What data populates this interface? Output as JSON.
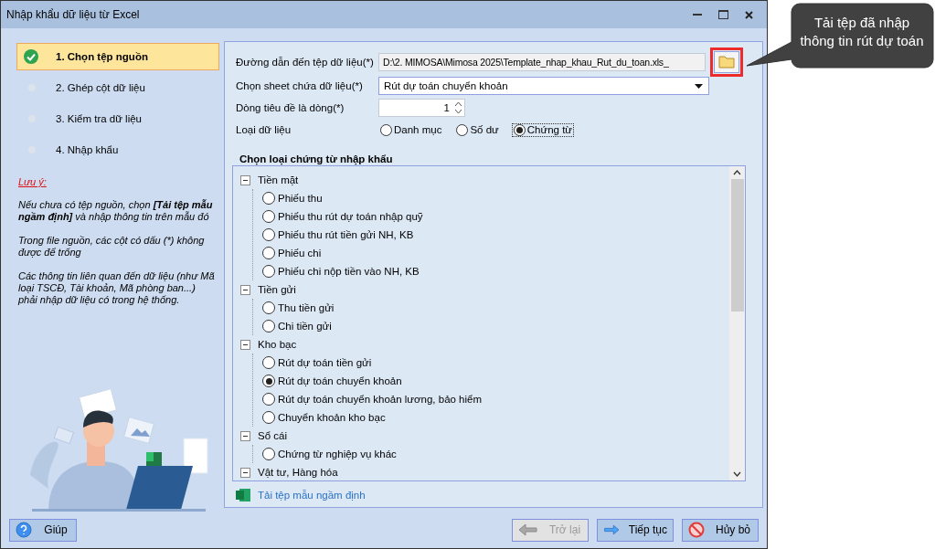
{
  "window": {
    "title": "Nhập khẩu dữ liệu từ Excel"
  },
  "steps": [
    {
      "label": "1. Chọn tệp nguồn",
      "selected": true
    },
    {
      "label": "2. Ghép cột dữ liệu",
      "selected": false
    },
    {
      "label": "3. Kiểm tra dữ liệu",
      "selected": false
    },
    {
      "label": "4. Nhập khẩu",
      "selected": false
    }
  ],
  "note": {
    "title": "Lưu ý:",
    "paragraphs": [
      "Nếu chưa có tệp nguồn, chọn **[Tải tệp mẫu ngầm định]** và nhập thông tin trên mẫu đó",
      "Trong file nguồn, các cột có dấu (*) không được để trống",
      "Các thông tin liên quan đến dữ liệu (như Mã loại TSCĐ, Tài khoản, Mã phòng ban...) phải nhập dữ liệu có trong hệ thống."
    ]
  },
  "form": {
    "path_label": "Đường dẫn đến tệp dữ liệu(*)",
    "path_value": "D:\\2. MIMOSA\\Mimosa 2025\\Template_nhap_khau_Rut_du_toan.xls_",
    "sheet_label": "Chọn sheet chứa dữ liệu(*)",
    "sheet_value": "Rút dự toán chuyển khoản",
    "header_row_label": "Dòng tiêu đề là dòng(*)",
    "header_row_value": "1",
    "data_type_label": "Loại dữ liệu",
    "data_type_options": [
      {
        "label": "Danh mục",
        "selected": false
      },
      {
        "label": "Số dư",
        "selected": false
      },
      {
        "label": "Chứng từ",
        "selected": true
      }
    ]
  },
  "voucher_group": {
    "title": "Chọn loại chứng từ nhập khẩu",
    "tree": [
      {
        "label": "Tiền mặt",
        "expanded": true,
        "children": [
          {
            "label": "Phiếu thu",
            "selected": false
          },
          {
            "label": "Phiếu thu rút dự toán nhập quỹ",
            "selected": false
          },
          {
            "label": "Phiếu thu rút tiền gửi NH, KB",
            "selected": false
          },
          {
            "label": "Phiếu chi",
            "selected": false
          },
          {
            "label": "Phiếu chi nộp tiền vào NH, KB",
            "selected": false
          }
        ]
      },
      {
        "label": "Tiền gửi",
        "expanded": true,
        "children": [
          {
            "label": "Thu tiền gửi",
            "selected": false
          },
          {
            "label": "Chi tiền gửi",
            "selected": false
          }
        ]
      },
      {
        "label": "Kho bạc",
        "expanded": true,
        "children": [
          {
            "label": "Rút dự toán tiền gửi",
            "selected": false
          },
          {
            "label": "Rút dự toán chuyển khoản",
            "selected": true
          },
          {
            "label": "Rút dự toán chuyển khoản lương, bảo hiểm",
            "selected": false
          },
          {
            "label": "Chuyển khoản kho bạc",
            "selected": false
          }
        ]
      },
      {
        "label": "Sổ cái",
        "expanded": true,
        "children": [
          {
            "label": "Chứng từ nghiệp vụ khác",
            "selected": false
          }
        ]
      },
      {
        "label": "Vật tư, Hàng hóa",
        "expanded": true
      }
    ]
  },
  "template_link": "Tải tệp mẫu ngầm định",
  "buttons": [
    {
      "kind": "help",
      "label": "Giúp",
      "disabled": false
    },
    {
      "kind": "back",
      "label": "Trở lại",
      "disabled": true
    },
    {
      "kind": "next",
      "label": "Tiếp tục",
      "disabled": false
    },
    {
      "kind": "cancel",
      "label": "Hủy bỏ",
      "disabled": false
    }
  ],
  "callout": {
    "lines": [
      "Tải tệp đã nhập",
      "thông tin rút dự toán"
    ]
  }
}
